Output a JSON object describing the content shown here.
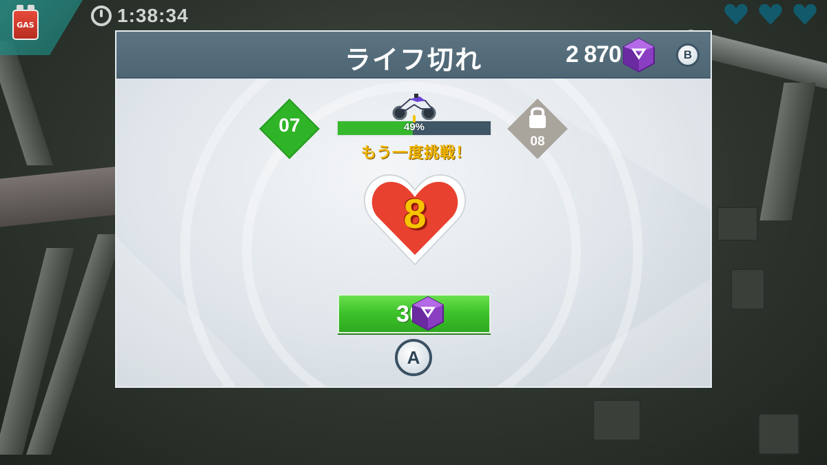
{
  "hud": {
    "timer": "1:38:34",
    "fuel_label": "GAS",
    "lives_icons": [
      "heart-icon",
      "heart-icon",
      "heart-icon"
    ],
    "colors": {
      "hud_accent": "#2a8f86",
      "heart_outline": "#0f5f73"
    }
  },
  "dialog": {
    "title": "ライフ切れ",
    "gem_count": "2 870",
    "close_button_label": "B",
    "current_level": "07",
    "next_level": "08",
    "next_level_locked": true,
    "progress": {
      "percent": 49,
      "label": "49%"
    },
    "retry_text": "もう一度挑戦！",
    "lives_remaining": "8",
    "refill": {
      "cost": "30",
      "currency_icon": "gem-icon",
      "confirm_button_label": "A"
    },
    "colors": {
      "header": "#5c7482",
      "level_current": "#2fb427",
      "level_locked": "#a9a49c",
      "progress_fill": "#36b82c",
      "retry_text": "#f4b600",
      "heart": "#e8412f",
      "gem": "#8a3fc2",
      "refill_button": "#3fc42c"
    }
  }
}
